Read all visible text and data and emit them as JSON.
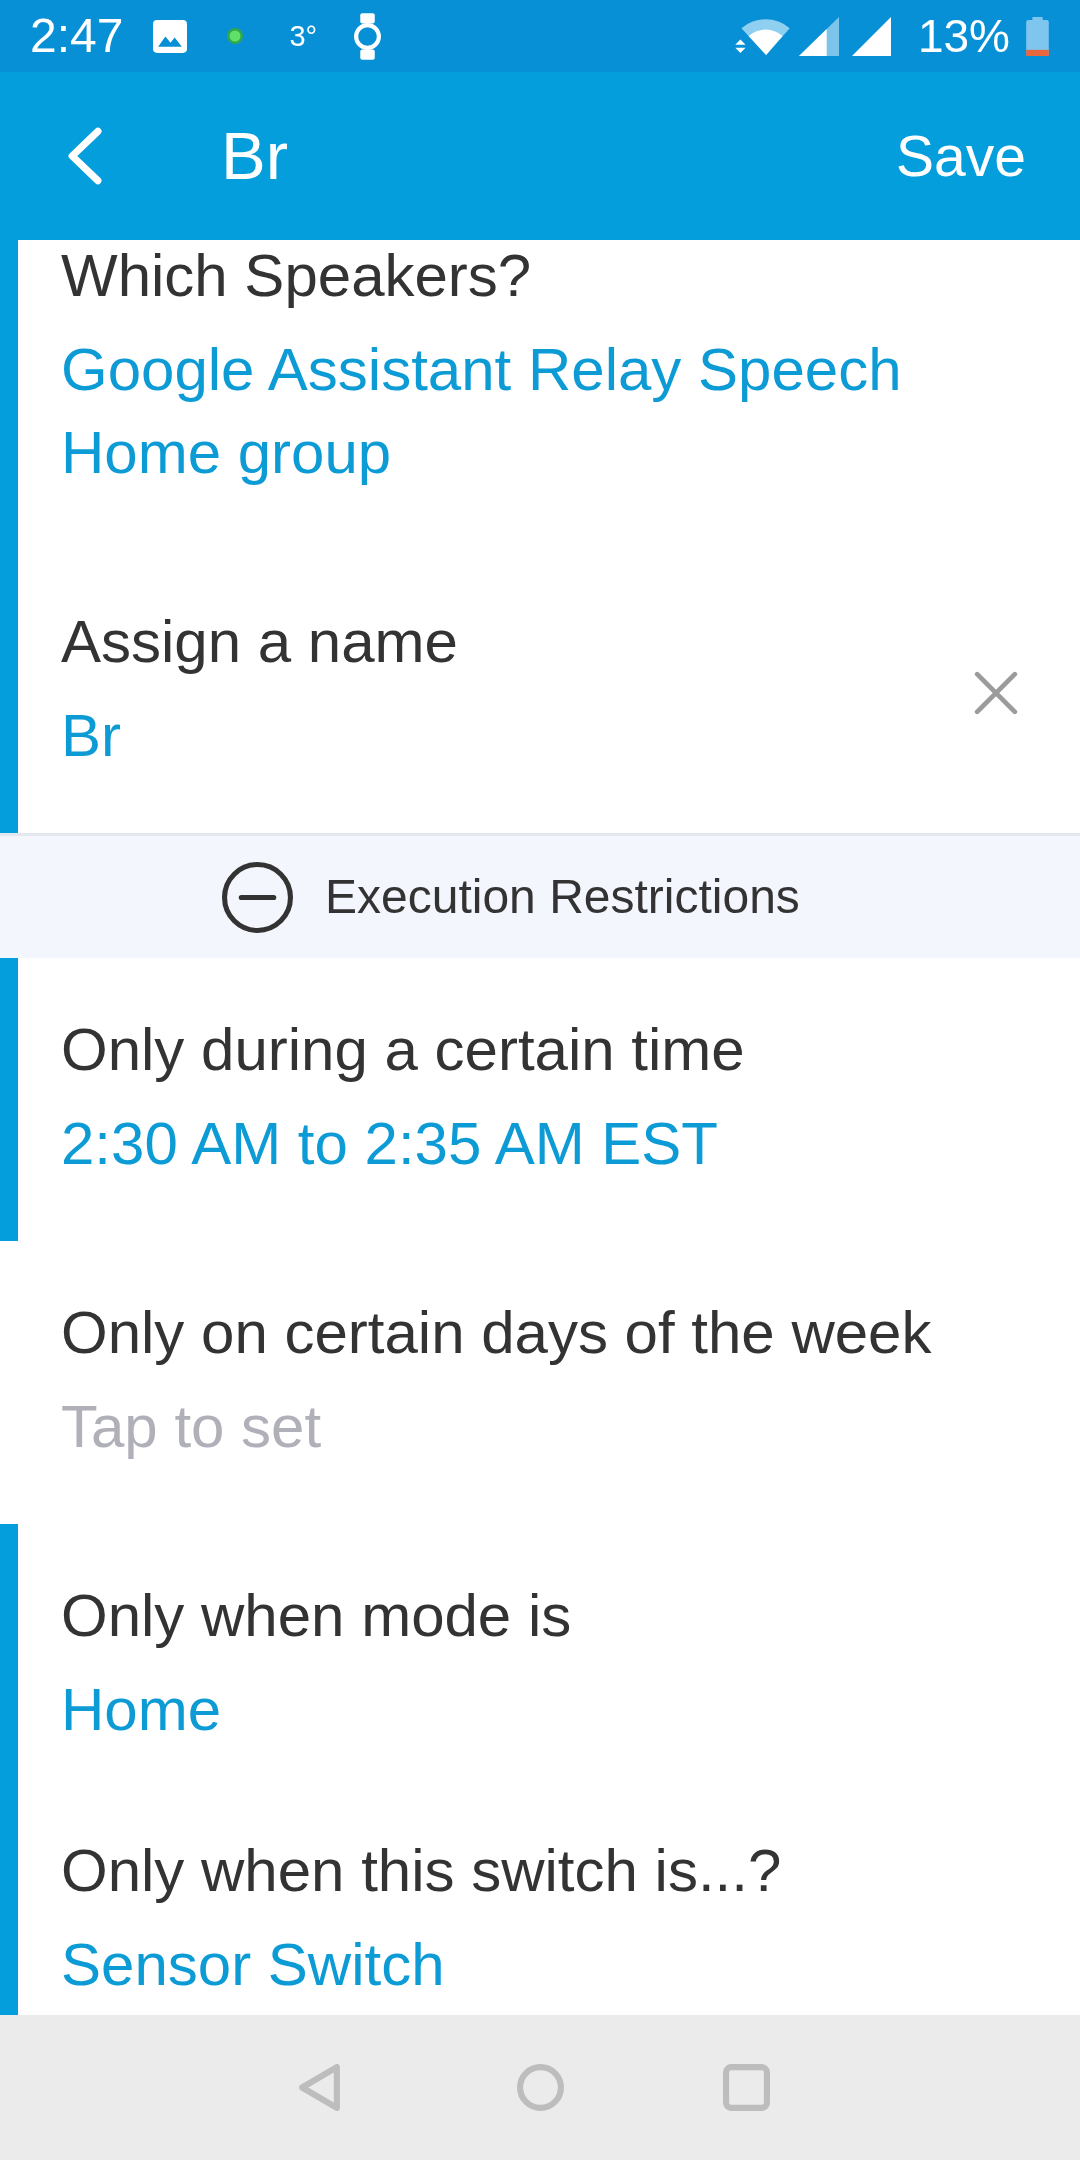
{
  "status_bar": {
    "time": "2:47",
    "temperature": "3°",
    "battery": "13%"
  },
  "app_bar": {
    "title": "Br",
    "action": "Save"
  },
  "settings": [
    {
      "label": "Which Speakers?",
      "values": [
        "Google Assistant Relay Speech",
        "Home group"
      ],
      "configured": true,
      "clearable": false
    },
    {
      "label": "Assign a name",
      "values": [
        "Br"
      ],
      "configured": true,
      "clearable": true
    }
  ],
  "restrictions": {
    "title": "Execution Restrictions",
    "expanded": true,
    "items": [
      {
        "label": "Only during a certain time",
        "values": [
          "2:30 AM to 2:35 AM EST"
        ],
        "configured": true
      },
      {
        "label": "Only on certain days of the week",
        "placeholder": "Tap to set",
        "configured": false
      },
      {
        "label": "Only when mode is",
        "values": [
          "Home"
        ],
        "configured": true
      },
      {
        "label": "Only when this switch is...?",
        "values": [
          "Sensor Switch"
        ],
        "configured": true
      }
    ]
  }
}
